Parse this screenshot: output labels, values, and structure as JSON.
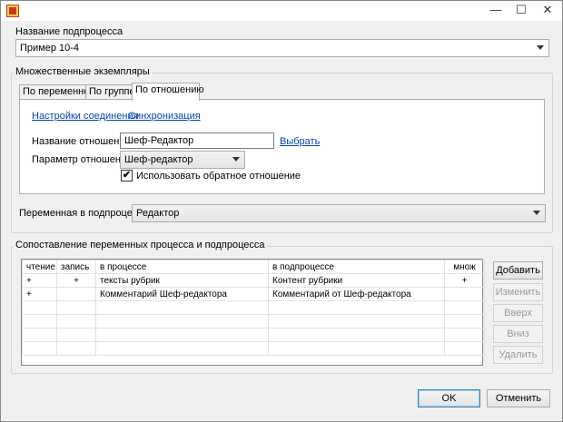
{
  "window": {
    "title": "",
    "minimize_glyph": "—",
    "maximize_glyph": "☐",
    "close_glyph": "✕"
  },
  "subprocess": {
    "label": "Название подпроцесса",
    "value": "Пример 10-4"
  },
  "multi": {
    "label": "Множественные экземпляры",
    "tabs": [
      {
        "label": "По переменной"
      },
      {
        "label": "По группе"
      },
      {
        "label": "По отношению"
      }
    ],
    "links": {
      "connection": "Настройки соединения",
      "sync": "Синхронизация"
    },
    "relation_name_label": "Название отношения",
    "relation_name_value": "Шеф-Редактор",
    "choose_link": "Выбрать",
    "relation_param_label": "Параметр отношения",
    "relation_param_value": "Шеф-редактор",
    "reverse_label": "Использовать обратное отношение",
    "reverse_checked": "✔"
  },
  "subvar": {
    "label": "Переменная в подпроцессе:",
    "value": "Редактор"
  },
  "mapping": {
    "label": "Сопоставление переменных процесса и подпроцесса",
    "columns": [
      "чтение",
      "запись",
      "в процессе",
      "в подпроцессе",
      "множ"
    ],
    "rows": [
      [
        "+",
        "+",
        "тексты рубрик",
        "Контент рубрики",
        "+"
      ],
      [
        "+",
        "",
        "Комментарий Шеф-редактора",
        "Комментарий от Шеф-редактора",
        ""
      ]
    ],
    "buttons": {
      "add": "Добавить",
      "edit": "Изменить",
      "up": "Вверх",
      "down": "Вниз",
      "delete": "Удалить"
    }
  },
  "footer": {
    "ok": "OK",
    "cancel": "Отменить"
  }
}
